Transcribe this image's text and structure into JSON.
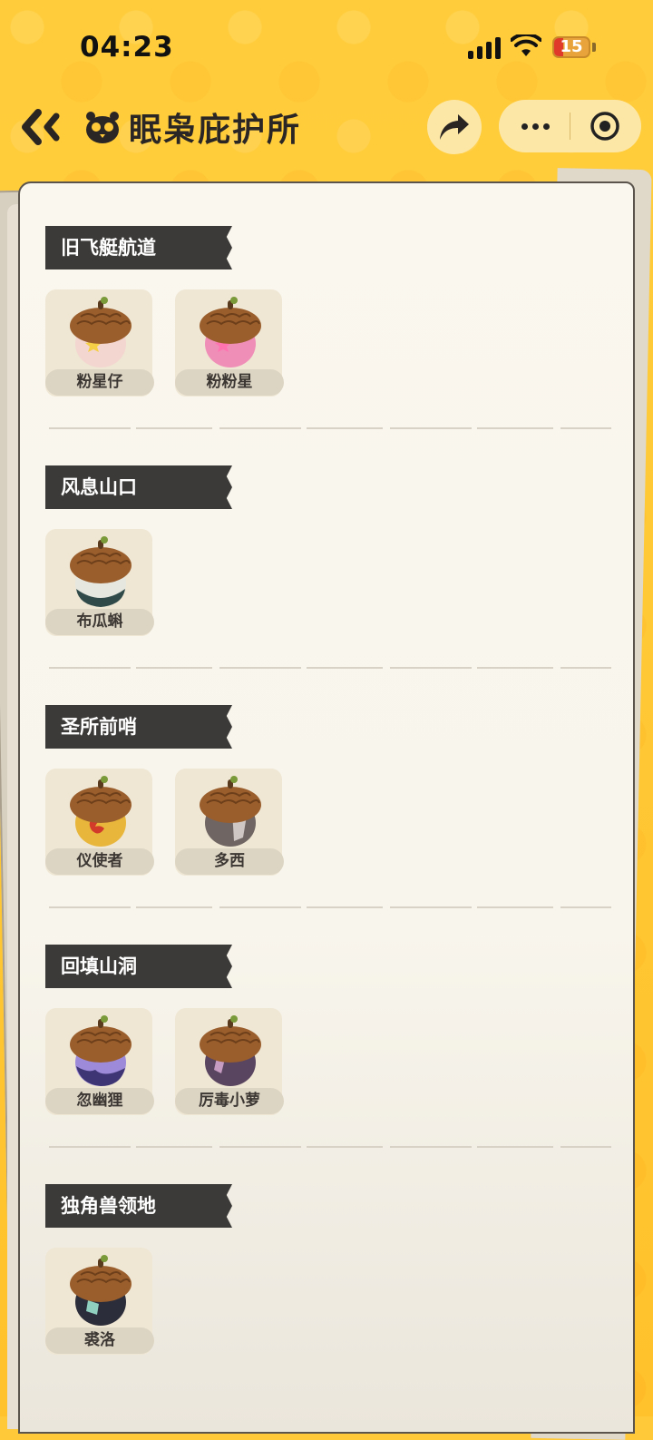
{
  "status_bar": {
    "time": "04:23",
    "battery": "15"
  },
  "nav": {
    "title": "眠枭庇护所"
  },
  "sections": [
    {
      "title": "旧飞艇航道",
      "items": [
        {
          "name": "粉星仔",
          "color": "#f3d6d0",
          "accent": "#f5d046"
        },
        {
          "name": "粉粉星",
          "color": "#ef8fb8",
          "accent": "#ff73b0"
        }
      ]
    },
    {
      "title": "风息山口",
      "items": [
        {
          "name": "布瓜蝌",
          "color": "#e6e7df",
          "accent": "#2f4a48"
        }
      ]
    },
    {
      "title": "圣所前哨",
      "items": [
        {
          "name": "仪使者",
          "color": "#e8b63a",
          "accent": "#d23a2a"
        },
        {
          "name": "多西",
          "color": "#6f6562",
          "accent": "#cfc7c4"
        }
      ]
    },
    {
      "title": "回填山洞",
      "items": [
        {
          "name": "忽幽狸",
          "color": "#9d8ad8",
          "accent": "#3e3575"
        },
        {
          "name": "厉毒小萝",
          "color": "#5a4560",
          "accent": "#c79cc2"
        }
      ]
    },
    {
      "title": "独角兽领地",
      "items": [
        {
          "name": "裘洛",
          "color": "#2c2d3a",
          "accent": "#8fd0bf"
        }
      ]
    }
  ]
}
